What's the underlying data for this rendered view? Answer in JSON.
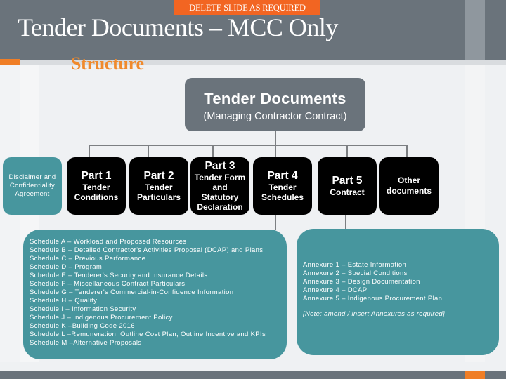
{
  "header": {
    "tag": "DELETE SLIDE AS REQUIRED",
    "title": "Tender Documents – MCC Only",
    "subtitle": "Structure"
  },
  "root": {
    "title": "Tender Documents",
    "subtitle": "(Managing Contractor Contract)"
  },
  "boxes": {
    "disclaimer": [
      "Disclaimer and",
      "Confidentiality",
      "Agreement"
    ],
    "part1": {
      "part": "Part 1",
      "desc": [
        "Tender",
        "Conditions"
      ]
    },
    "part2": {
      "part": "Part 2",
      "desc": [
        "Tender",
        "Particulars"
      ]
    },
    "part3": {
      "part": "Part 3",
      "desc": [
        "Tender Form",
        "and",
        "Statutory",
        "Declaration"
      ]
    },
    "part4": {
      "part": "Part 4",
      "desc": [
        "Tender",
        "Schedules"
      ]
    },
    "part5": {
      "part": "Part 5",
      "desc": [
        "Contract"
      ]
    },
    "other": [
      "Other",
      "documents"
    ]
  },
  "schedules": [
    "Schedule A – Workload and Proposed Resources",
    "Schedule B – Detailed Contractor's Activities Proposal (DCAP) and Plans",
    "Schedule C – Previous Performance",
    "Schedule D – Program",
    "Schedule E – Tenderer's Security and Insurance Details",
    "Schedule F – Miscellaneous Contract Particulars",
    "Schedule G – Tenderer's Commercial-in-Confidence Information",
    "Schedule H – Quality",
    "Schedule I – Information Security",
    "Schedule J –  Indigenous Procurement Policy",
    "Schedule K –Building Code 2016",
    "Schedule L –Remuneration, Outline Cost Plan, Outline Incentive and KPIs",
    "Schedule M –Alternative Proposals"
  ],
  "annexures": [
    "Annexure 1 – Estate Information",
    "Annexure 2 – Special Conditions",
    "Annexure 3 –  Design Documentation",
    "Annexure 4 –  DCAP",
    "Annexure 5 –  Indigenous Procurement Plan"
  ],
  "annex_note": "[Note: amend / insert Annexures as required]"
}
